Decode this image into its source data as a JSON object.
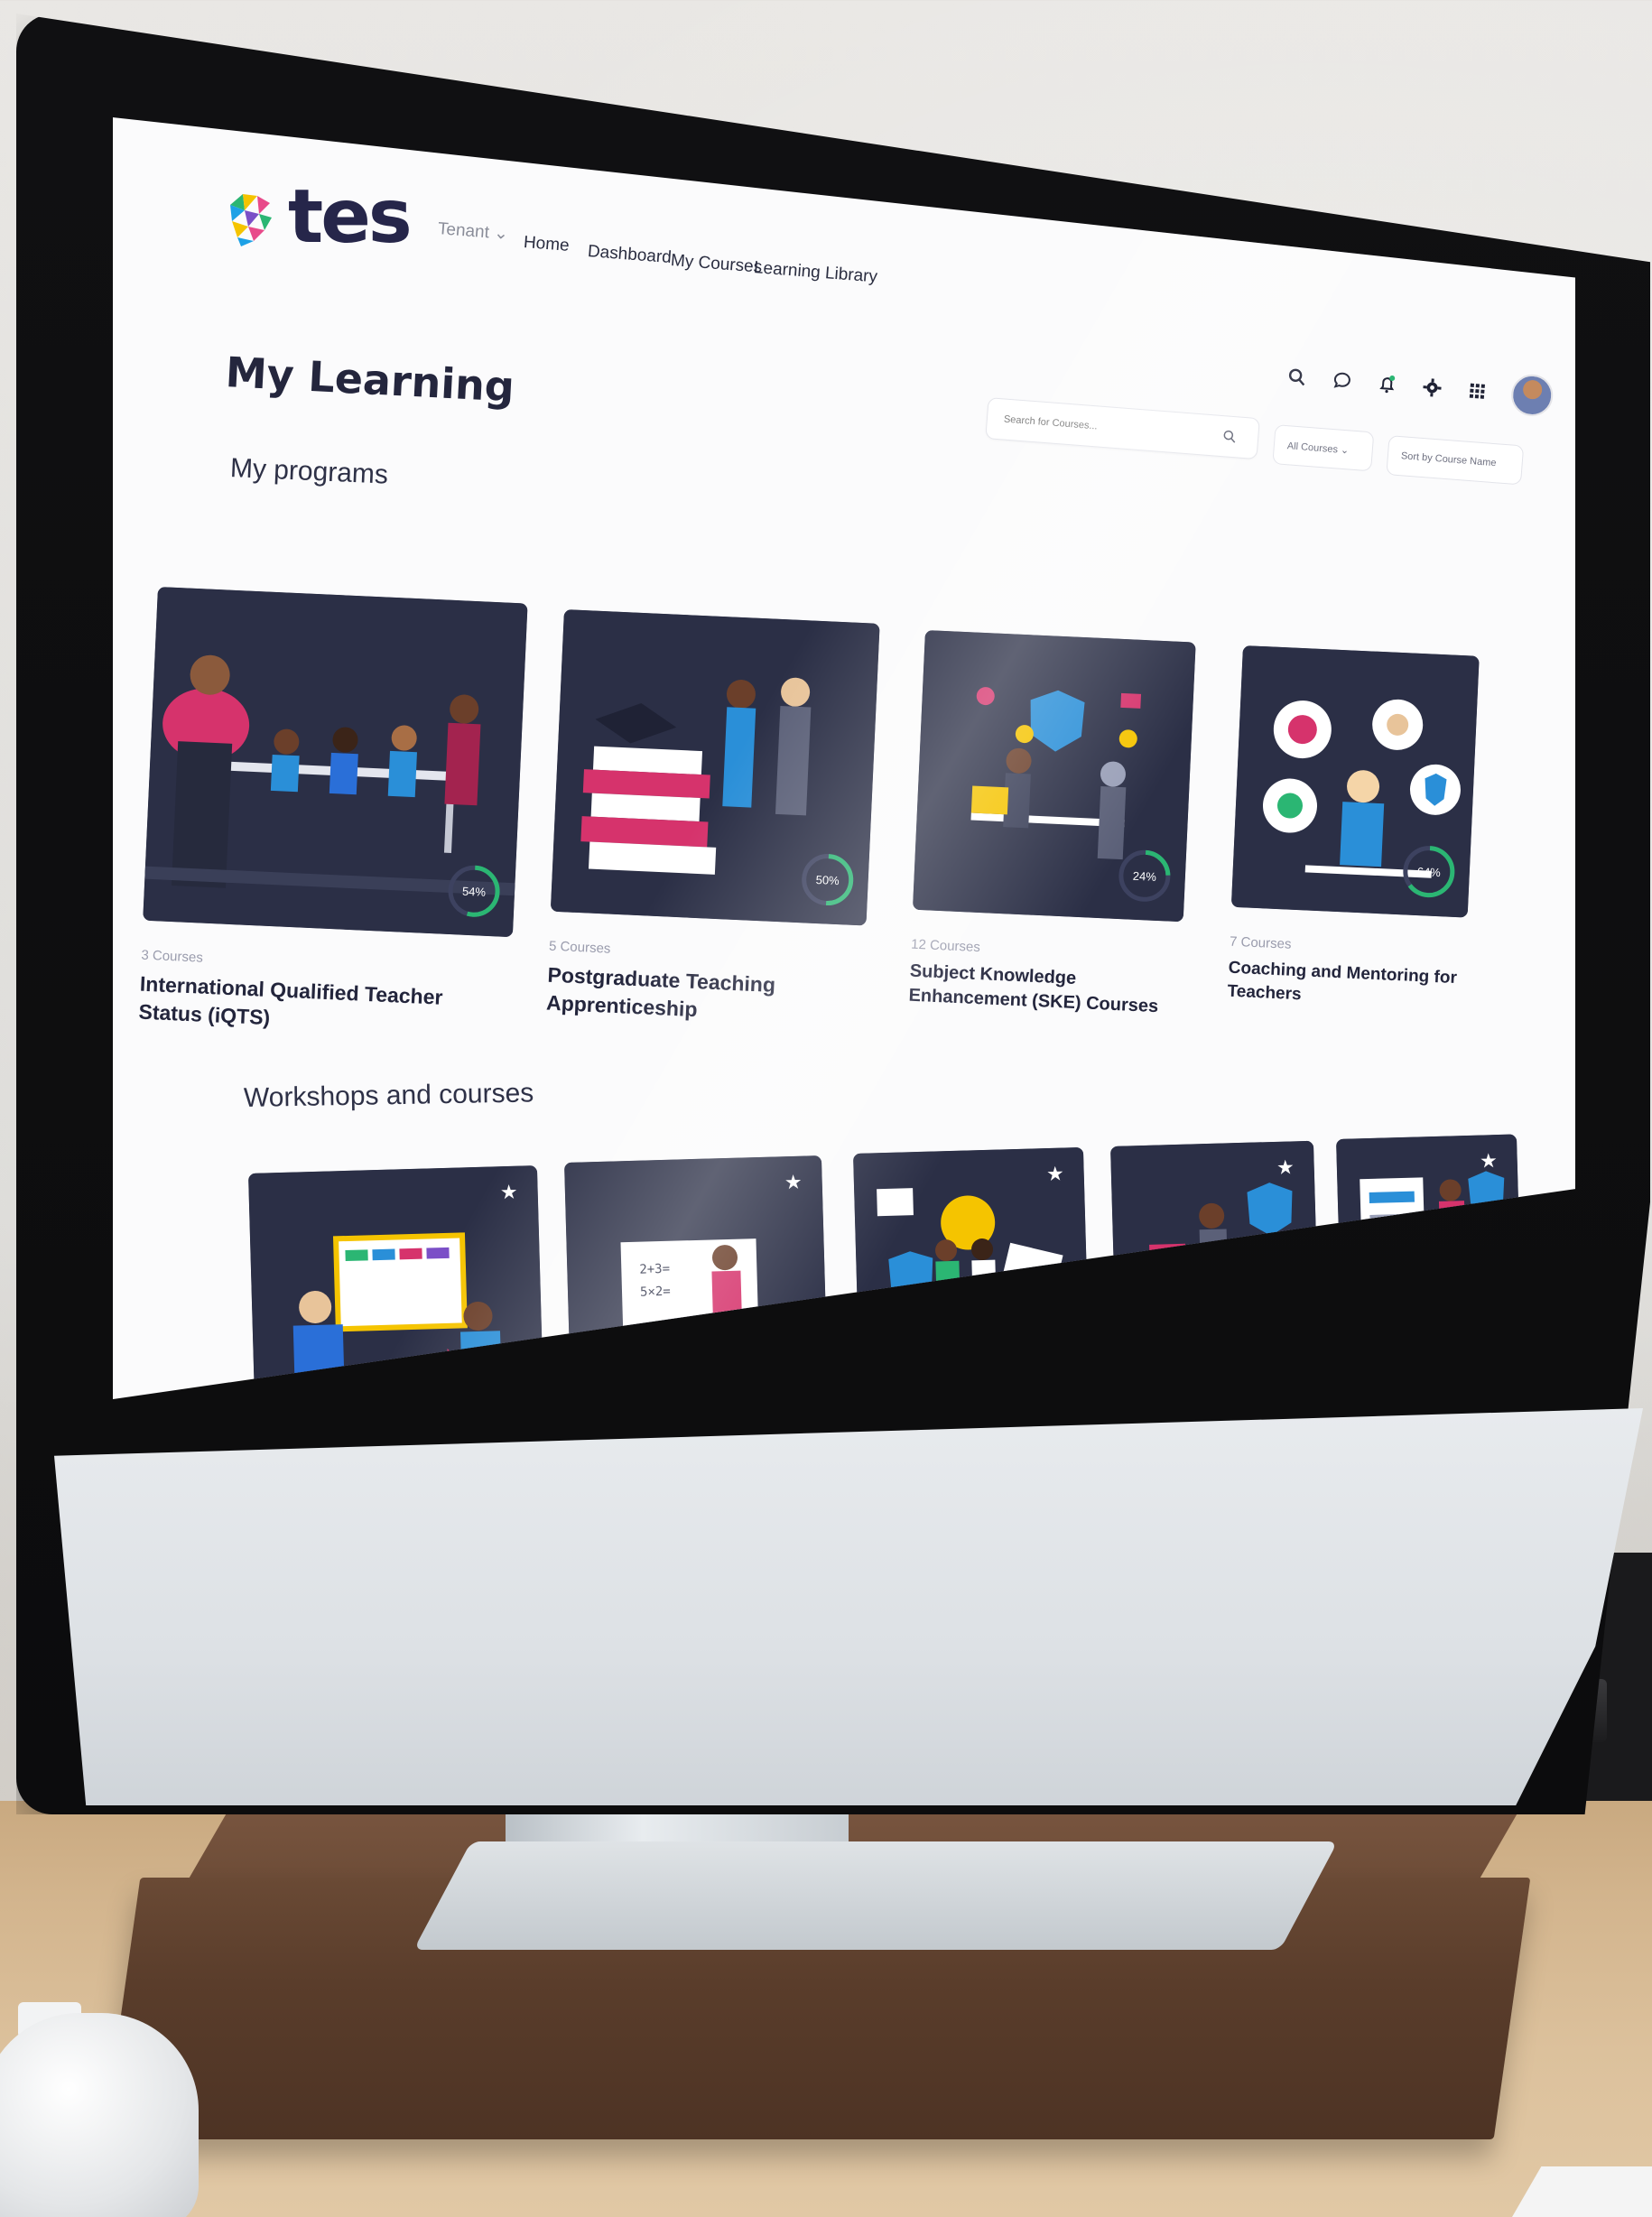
{
  "app": {
    "brand": "tes"
  },
  "nav": {
    "tenant_label": "Tenant ⌄",
    "items": [
      {
        "label": "Home"
      },
      {
        "label": "Dashboard"
      },
      {
        "label": "My Courses"
      },
      {
        "label": "Learning Library"
      }
    ]
  },
  "page": {
    "title": "My Learning"
  },
  "toolbar": {
    "icons": [
      "search-icon",
      "chat-icon",
      "bell-icon",
      "gear-icon",
      "apps-grid-icon"
    ],
    "notification_color": "#2bb673"
  },
  "filters": {
    "search_placeholder": "Search for Courses...",
    "category_value": "All Courses ⌄",
    "sort_value": "Sort by Course Name"
  },
  "programs": {
    "title": "My programs",
    "items": [
      {
        "count": "3 Courses",
        "title": "International Qualified Teacher Status (iQTS)",
        "progress": "54%",
        "progress_value": 54
      },
      {
        "count": "5 Courses",
        "title": "Postgraduate Teaching Apprenticeship",
        "progress": "50%",
        "progress_value": 50
      },
      {
        "count": "12 Courses",
        "title": "Subject Knowledge Enhancement (SKE) Courses",
        "progress": "24%",
        "progress_value": 24
      },
      {
        "count": "7 Courses",
        "title": "Coaching and Mentoring for Teachers",
        "progress": "64%",
        "progress_value": 64
      }
    ]
  },
  "workshops": {
    "title": "Workshops and courses",
    "items": [
      {
        "icon": "star-icon"
      },
      {
        "icon": "star-icon"
      },
      {
        "icon": "star-icon"
      },
      {
        "icon": "star-icon"
      },
      {
        "icon": "star-icon"
      }
    ]
  },
  "colors": {
    "card_bg": "#2b2f46",
    "progress_green": "#2bb673",
    "brand_navy": "#26264a",
    "accent_pink": "#d6336c"
  }
}
